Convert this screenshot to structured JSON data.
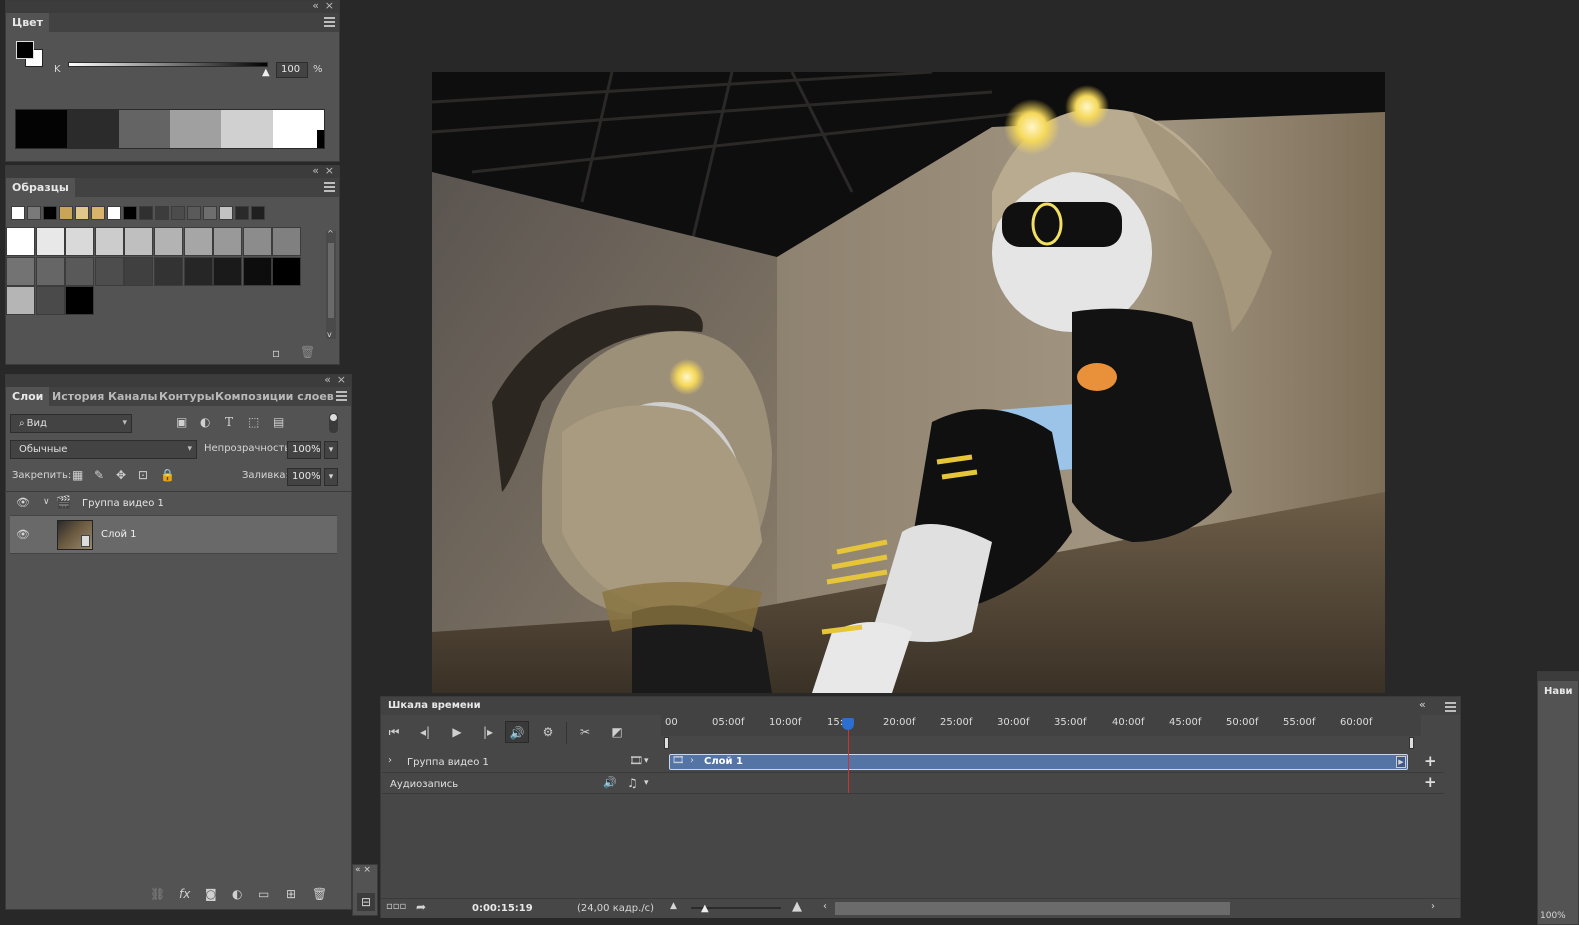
{
  "color_panel": {
    "tab": "Цвет",
    "channel_label": "K",
    "value": "100",
    "unit": "%",
    "ramp_colors": [
      "#030303",
      "#2b2b2b",
      "#646464",
      "#a0a0a0",
      "#d0d0d0",
      "#ffffff"
    ]
  },
  "swatches_panel": {
    "tab": "Образцы",
    "recent": [
      "#ffffff",
      "#7a7a7a",
      "#000000",
      "#c9a55a",
      "#e0c78a",
      "#d8b46a",
      "#ffffff",
      "#000000",
      "#303030",
      "#3c3c3c",
      "#4c4c4c",
      "#5a5a5a",
      "#6e6e6e",
      "#c2c2c2",
      "#2a2a2a",
      "#1f1f1f"
    ],
    "grid": [
      "#ffffff",
      "#e8e8e8",
      "#d9d9d9",
      "#cccccc",
      "#bfbfbf",
      "#b3b3b3",
      "#a6a6a6",
      "#999999",
      "#8c8c8c",
      "#808080",
      "#737373",
      "#666666",
      "#595959",
      "#4d4d4d",
      "#404040",
      "#333333",
      "#262626",
      "#1a1a1a",
      "#0d0d0d",
      "#000000",
      "#b5b5b5",
      "#4a4a4a",
      "#000000"
    ]
  },
  "layers_panel": {
    "tabs": [
      "Слои",
      "История",
      "Каналы",
      "Контуры",
      "Композиции слоев"
    ],
    "filter_label": "Вид",
    "blend_mode": "Обычные",
    "opacity_label": "Непрозрачность:",
    "opacity_value": "100%",
    "lock_label": "Закрепить:",
    "fill_label": "Заливка:",
    "fill_value": "100%",
    "layers": [
      {
        "name": "Группа видео 1"
      },
      {
        "name": "Слой 1"
      }
    ]
  },
  "timeline": {
    "title": "Шкала времени",
    "ruler": [
      "00",
      "05:00f",
      "10:00f",
      "15:",
      "20:00f",
      "25:00f",
      "30:00f",
      "35:00f",
      "40:00f",
      "45:00f",
      "50:00f",
      "55:00f",
      "60:00f"
    ],
    "tracks": [
      {
        "name": "Группа видео 1",
        "clip": "Слой 1"
      },
      {
        "name": "Аудиозапись"
      }
    ],
    "current_time": "0:00:15:19",
    "fps": "(24,00 кадр./с)"
  },
  "navigator": {
    "label": "Нави",
    "zoom": "100%"
  },
  "colors": {
    "panel": "#535353",
    "workspace": "#282828",
    "clip": "#5072a8",
    "playhead": "#d03030",
    "accent": "#1473e6"
  }
}
